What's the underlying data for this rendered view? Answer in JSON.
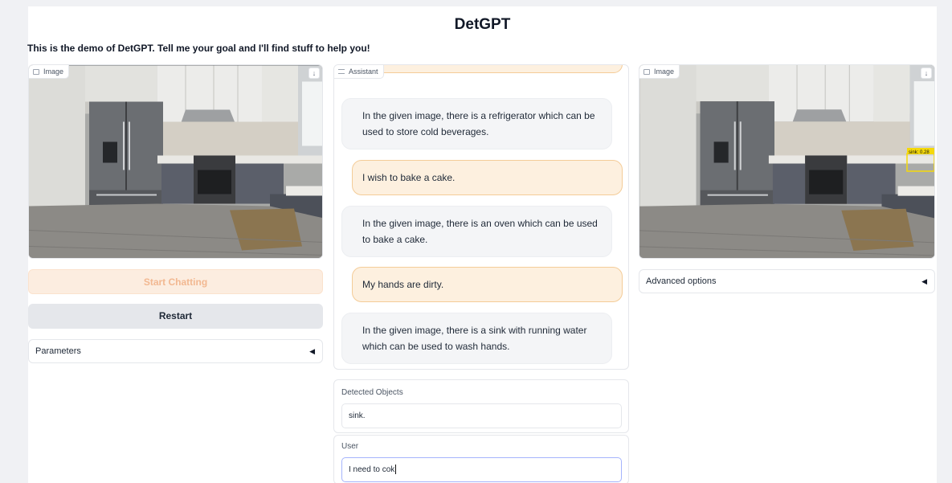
{
  "app": {
    "title": "DetGPT",
    "description": "This is the demo of DetGPT. Tell me your goal and I'll find stuff to help you!"
  },
  "left": {
    "image_label": "Image",
    "start_button": "Start Chatting",
    "restart_button": "Restart",
    "parameters_label": "Parameters"
  },
  "chat": {
    "label": "Assistant",
    "messages": [
      {
        "role": "assistant",
        "text": "In the given image, there is a refrigerator which can be used to store cold beverages."
      },
      {
        "role": "user",
        "text": "I wish to bake a cake."
      },
      {
        "role": "assistant",
        "text": "In the given image, there is an oven which can be used to bake a cake."
      },
      {
        "role": "user",
        "text": "My hands are dirty."
      },
      {
        "role": "assistant",
        "text": "In the given image, there is a sink with running water which can be used to wash hands."
      }
    ]
  },
  "detected": {
    "label": "Detected Objects",
    "value": "sink."
  },
  "user_input": {
    "label": "User",
    "value": "I need to cok"
  },
  "right": {
    "image_label": "Image",
    "advanced_label": "Advanced options",
    "detection_tag": "sink: 0.28"
  },
  "icons": [
    "image-icon",
    "download-icon",
    "chatbot-icon",
    "collapse-arrow-icon"
  ],
  "colors": {
    "start_bg": "#fcede0",
    "start_text": "#f2b891",
    "user_bubble": "#fdf0df",
    "user_border": "#f4cc98",
    "bot_bubble": "#f4f5f7",
    "detection_box": "#f5d90a"
  }
}
